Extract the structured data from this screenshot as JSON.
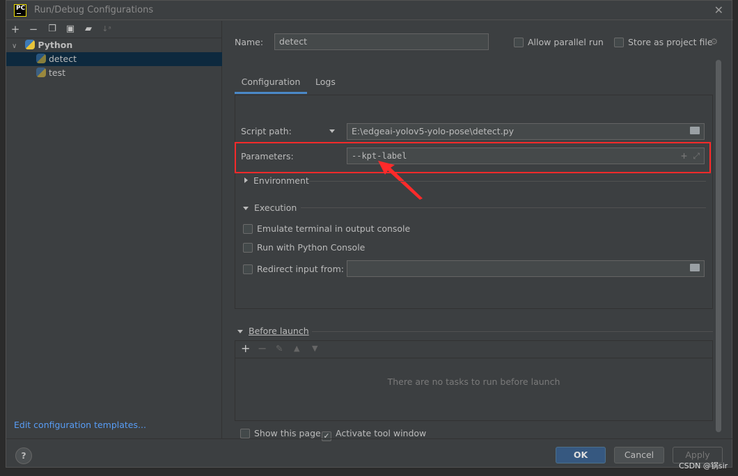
{
  "window": {
    "title": "Run/Debug Configurations",
    "logo": "PC"
  },
  "toolbar": [
    "plus-icon",
    "minus-icon",
    "copy-icon",
    "save-icon",
    "new-folder-icon",
    "sort-icon"
  ],
  "tree": {
    "group": "Python",
    "items": [
      {
        "label": "detect",
        "selected": true
      },
      {
        "label": "test",
        "selected": false
      }
    ]
  },
  "edit_templates": "Edit configuration templates...",
  "name": {
    "label": "Name:",
    "value": "detect"
  },
  "allow_parallel": {
    "label": "Allow parallel run",
    "checked": false
  },
  "store_project": {
    "label": "Store as project file",
    "checked": false
  },
  "tabs": [
    {
      "label": "Configuration",
      "active": true
    },
    {
      "label": "Logs",
      "active": false
    }
  ],
  "script_path": {
    "label": "Script path:",
    "value": "E:\\edgeai-yolov5-yolo-pose\\detect.py"
  },
  "parameters": {
    "label": "Parameters:",
    "value": "--kpt-label"
  },
  "environment": "Environment",
  "execution": "Execution",
  "options": [
    {
      "label": "Emulate terminal in output console",
      "checked": false
    },
    {
      "label": "Run with Python Console",
      "checked": false
    }
  ],
  "redirect": {
    "label": "Redirect input from:",
    "value": "",
    "checked": false
  },
  "before_launch": {
    "label": "Before launch",
    "empty": "There are no tasks to run before launch"
  },
  "show_page": {
    "label": "Show this page",
    "checked": false
  },
  "activate_tool": {
    "label": "Activate tool window",
    "checked": true
  },
  "buttons": {
    "help": "?",
    "ok": "OK",
    "cancel": "Cancel",
    "apply": "Apply"
  },
  "watermark": "CSDN @锅sir",
  "colors": {
    "highlight": "#ff2a2a",
    "accent": "#4a88c7",
    "ok": "#365880"
  }
}
